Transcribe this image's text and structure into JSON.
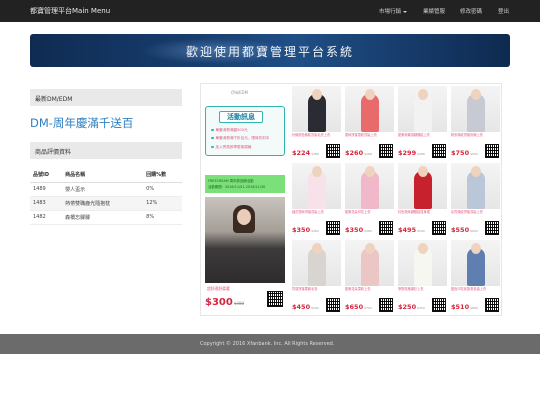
{
  "navbar": {
    "brand": "都寶管理平台Main Menu",
    "items": [
      {
        "label": "市場行銷",
        "has_dropdown": true
      },
      {
        "label": "業績管服"
      },
      {
        "label": "修改密碼"
      },
      {
        "label": "登出"
      }
    ]
  },
  "banner": {
    "text": "歡迎使用都寶管理平台系統"
  },
  "dm_panel": {
    "heading": "最新DM/EDM",
    "promo_title": "DM-周年慶滿千送百"
  },
  "ranking": {
    "heading": "商品評價資料",
    "columns": [
      "品號ID",
      "商品名稱",
      "回購%數"
    ],
    "rows": [
      [
        "1489",
        "嬰人盃示",
        "0%"
      ],
      [
        "1483",
        "熱帶雙職鹿光隨抱枕",
        "12%"
      ],
      [
        "1482",
        "森橋忘腳腳",
        "8%"
      ]
    ]
  },
  "flyer": {
    "logo": "伊甸EDM",
    "activity_title": "活動訊息",
    "activity_lines": [
      "單筆消費滿額300元",
      "單筆消費滿千折百元，限時折扣中",
      "加入會員即享優惠價格"
    ],
    "green_lines": [
      "FREECREAM 周年慶回饋活動",
      "活動期間：2016/11/01-2016/11/30"
    ],
    "featured": {
      "caption": "超舒適舒柔暖",
      "price": "300",
      "orig": "$388"
    },
    "products": [
      {
        "desc": "針織撞色條紋寬鬆毛衣上衣",
        "price": "224",
        "orig": "$388",
        "color": "#2b2b33"
      },
      {
        "desc": "蕾絲拼接雪紡寬鬆上衣",
        "price": "260",
        "orig": "$388",
        "color": "#e96a6a"
      },
      {
        "desc": "甜美荷葉領蝴蝶結上衣",
        "price": "299",
        "orig": "$388",
        "color": "#f2f2f2"
      },
      {
        "desc": "韓系條紋拼接針織上衣",
        "price": "750",
        "orig": "$999",
        "color": "#c7c9d3"
      },
      {
        "desc": "繡花蕾絲拼接寬鬆上衣",
        "price": "350",
        "orig": "$480",
        "color": "#f6e2e8"
      },
      {
        "desc": "甜美花朵印花上衣",
        "price": "350",
        "orig": "$480",
        "color": "#f0b8c9"
      },
      {
        "desc": "紅色蕾絲蝴蝶結連身裙",
        "price": "495",
        "orig": "$590",
        "color": "#c8212e"
      },
      {
        "desc": "氣質條紋拼接寬鬆上衣",
        "price": "550",
        "orig": "$690",
        "color": "#b9c7d9"
      },
      {
        "desc": "質感拼接柔軟毛衣",
        "price": "450",
        "orig": "$590",
        "color": "#d8d4cf"
      },
      {
        "desc": "甜美花朵雪紡上衣",
        "price": "650",
        "orig": "$790",
        "color": "#ecc5c5"
      },
      {
        "desc": "學院風格襯衫上衣",
        "price": "250",
        "orig": "$350",
        "color": "#f7f7f2"
      },
      {
        "desc": "藍色印花民族風長袖上衣",
        "price": "510",
        "orig": "$680",
        "color": "#5f7fb0"
      }
    ]
  },
  "footer": {
    "text": "Copyright © 2016 Xfanbank. Inc. All Rights Reserved."
  },
  "colors": {
    "navbar": "#222222",
    "accent": "#2f7fc1",
    "price": "#d6263d",
    "footer": "#6b6b6b"
  }
}
